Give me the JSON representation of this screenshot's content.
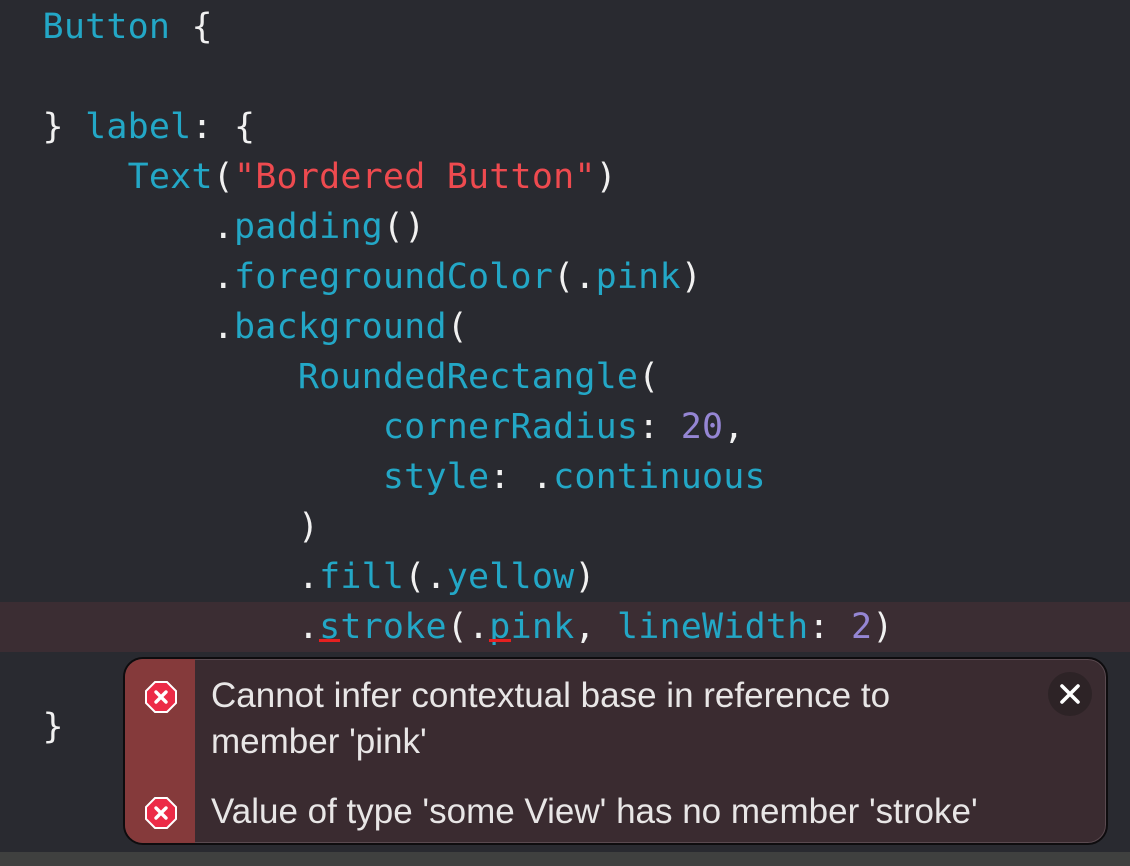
{
  "editor": {
    "lines": [
      {
        "indent": "  ",
        "tokens": [
          {
            "t": "id",
            "v": "Button"
          },
          {
            "t": "p",
            "v": " {"
          }
        ]
      },
      {
        "indent": "",
        "tokens": []
      },
      {
        "indent": "  ",
        "tokens": [
          {
            "t": "p",
            "v": "} "
          },
          {
            "t": "id",
            "v": "label"
          },
          {
            "t": "p",
            "v": ": {"
          }
        ]
      },
      {
        "indent": "      ",
        "tokens": [
          {
            "t": "id",
            "v": "Text"
          },
          {
            "t": "p",
            "v": "("
          },
          {
            "t": "str",
            "v": "\"Bordered Button\""
          },
          {
            "t": "p",
            "v": ")"
          }
        ]
      },
      {
        "indent": "          ",
        "tokens": [
          {
            "t": "p",
            "v": "."
          },
          {
            "t": "id",
            "v": "padding"
          },
          {
            "t": "p",
            "v": "()"
          }
        ]
      },
      {
        "indent": "          ",
        "tokens": [
          {
            "t": "p",
            "v": "."
          },
          {
            "t": "id",
            "v": "foregroundColor"
          },
          {
            "t": "p",
            "v": "(."
          },
          {
            "t": "id",
            "v": "pink"
          },
          {
            "t": "p",
            "v": ")"
          }
        ]
      },
      {
        "indent": "          ",
        "tokens": [
          {
            "t": "p",
            "v": "."
          },
          {
            "t": "id",
            "v": "background"
          },
          {
            "t": "p",
            "v": "("
          }
        ]
      },
      {
        "indent": "              ",
        "tokens": [
          {
            "t": "id",
            "v": "RoundedRectangle"
          },
          {
            "t": "p",
            "v": "("
          }
        ]
      },
      {
        "indent": "                  ",
        "tokens": [
          {
            "t": "id",
            "v": "cornerRadius"
          },
          {
            "t": "p",
            "v": ": "
          },
          {
            "t": "num",
            "v": "20"
          },
          {
            "t": "p",
            "v": ","
          }
        ]
      },
      {
        "indent": "                  ",
        "tokens": [
          {
            "t": "id",
            "v": "style"
          },
          {
            "t": "p",
            "v": ": ."
          },
          {
            "t": "id",
            "v": "continuous"
          }
        ]
      },
      {
        "indent": "              ",
        "tokens": [
          {
            "t": "p",
            "v": ")"
          }
        ]
      },
      {
        "indent": "              ",
        "tokens": [
          {
            "t": "p",
            "v": "."
          },
          {
            "t": "id",
            "v": "fill"
          },
          {
            "t": "p",
            "v": "(."
          },
          {
            "t": "id",
            "v": "yellow"
          },
          {
            "t": "p",
            "v": ")"
          }
        ]
      },
      {
        "indent": "              ",
        "error": true,
        "tokens": [
          {
            "t": "p",
            "v": "."
          },
          {
            "t": "id",
            "v": "s",
            "squiggle": true
          },
          {
            "t": "id",
            "v": "troke"
          },
          {
            "t": "p",
            "v": "(."
          },
          {
            "t": "id",
            "v": "p",
            "squiggle": true
          },
          {
            "t": "id",
            "v": "ink"
          },
          {
            "t": "p",
            "v": ", "
          },
          {
            "t": "id",
            "v": "lineWidth"
          },
          {
            "t": "p",
            "v": ": "
          },
          {
            "t": "num",
            "v": "2"
          },
          {
            "t": "p",
            "v": ")"
          }
        ]
      },
      {
        "indent": "",
        "tokens": []
      },
      {
        "indent": "  ",
        "tokens": [
          {
            "t": "p",
            "v": "}"
          }
        ]
      }
    ]
  },
  "error_popover": {
    "messages": [
      {
        "icon": "error-icon",
        "text": "Cannot infer contextual base in reference to member 'pink'"
      },
      {
        "icon": "error-icon",
        "text": "Value of type 'some View' has no member 'stroke'"
      }
    ],
    "close_icon": "close-icon"
  },
  "colors": {
    "background": "#292a30",
    "identifier": "#23a7c6",
    "string": "#ee4a4f",
    "number": "#9586d4",
    "error_line": "#3b2d33",
    "error_gutter": "#853a3b",
    "error_icon": "#ec2b47"
  }
}
